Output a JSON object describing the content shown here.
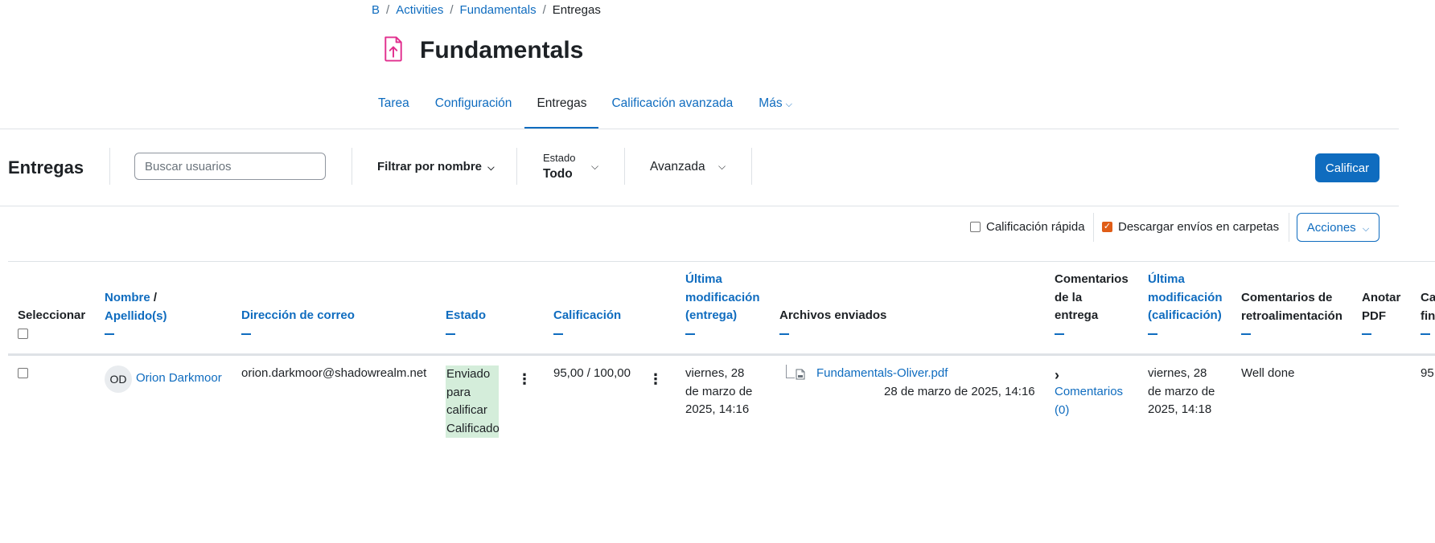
{
  "breadcrumb": {
    "items": [
      "B",
      "Activities",
      "Fundamentals"
    ],
    "current": "Entregas",
    "separator": "/"
  },
  "page": {
    "title": "Fundamentals",
    "icon": "assignment-upload-icon",
    "icon_color": "#e12f8e"
  },
  "tabs": [
    {
      "label": "Tarea"
    },
    {
      "label": "Configuración"
    },
    {
      "label": "Entregas",
      "active": true
    },
    {
      "label": "Calificación avanzada"
    },
    {
      "label": "Más"
    }
  ],
  "toolbar": {
    "title": "Entregas",
    "search_placeholder": "Buscar usuarios",
    "filter_name_label": "Filtrar por nombre",
    "estado_label": "Estado",
    "estado_value": "Todo",
    "advanced_label": "Avanzada",
    "grade_button": "Calificar"
  },
  "options": {
    "quick_grading": "Calificación rápida",
    "quick_grading_checked": false,
    "download_in_folders": "Descargar envíos en carpetas",
    "download_in_folders_checked": true,
    "actions_button": "Acciones"
  },
  "table": {
    "headers": {
      "select": "Seleccionar",
      "first_name": "Nombre",
      "name_sep": "/",
      "last_name": "Apellido(s)",
      "email": "Dirección de correo",
      "status": "Estado",
      "grade": "Calificación",
      "last_modified_submission": [
        "Última",
        "modificación",
        "(entrega)"
      ],
      "files": "Archivos enviados",
      "submission_comments": [
        "Comentarios",
        "de la",
        "entrega"
      ],
      "last_modified_grade": [
        "Última",
        "modificación",
        "(calificación)"
      ],
      "feedback_comments": [
        "Comentarios de",
        "retroalimentación"
      ],
      "annotate_pdf": [
        "Anotar",
        "PDF"
      ],
      "final_grade": [
        "Ca",
        "fin"
      ]
    },
    "rows": [
      {
        "initials": "OD",
        "name": "Orion Darkmoor",
        "email": "orion.darkmoor@shadowrealm.net",
        "status_lines": [
          "Enviado",
          "para",
          "calificar",
          "Calificado"
        ],
        "grade": "95,00 / 100,00",
        "last_modified_submission": [
          "viernes, 28",
          "de marzo de",
          "2025, 14:16"
        ],
        "file_name": "Fundamentals-Oliver.pdf",
        "file_date": "28 de marzo de 2025, 14:16",
        "comments": [
          "Comentarios",
          "(0)"
        ],
        "last_modified_grade": [
          "viernes, 28",
          "de marzo de",
          "2025, 14:18"
        ],
        "feedback": "Well done",
        "final_grade": "95,"
      }
    ]
  },
  "colors": {
    "link": "#0f6cbf",
    "status_bg": "#d4edda",
    "checkbox_checked": "#e05d17"
  }
}
